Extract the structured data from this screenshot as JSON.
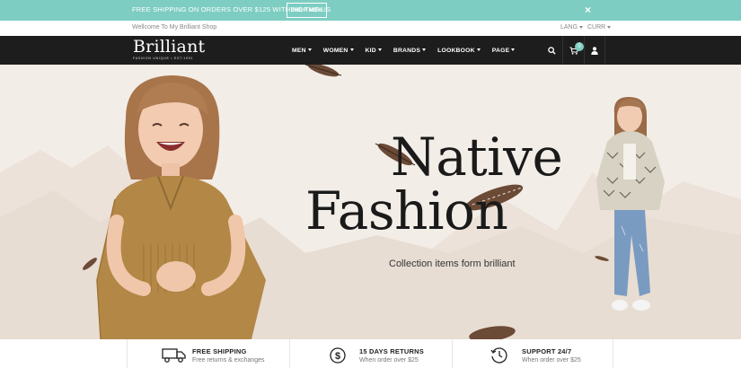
{
  "promo": {
    "text": "FREE SHIPPING ON ORDERS OVER $125 WITHING THE US",
    "button": "SHOP NOW"
  },
  "util": {
    "welcome": "Wellcome To My Brilliant Shop",
    "lang": "LANG",
    "curr": "CURR"
  },
  "brand": {
    "name": "Brilliant",
    "tagline": "FASHION UNIQUE • EST.1991"
  },
  "nav": {
    "items": [
      "MEN",
      "WOMEN",
      "KID",
      "BRANDS",
      "LOOKBOOK",
      "PAGE"
    ],
    "cart_count": "0"
  },
  "hero": {
    "line1": "Native",
    "line2": "Fashion",
    "subtitle": "Collection items form brilliant"
  },
  "features": [
    {
      "title": "FREE SHIPPING",
      "subtitle": "Free returns & exchanges",
      "icon": "truck-icon"
    },
    {
      "title": "15 DAYS RETURNS",
      "subtitle": "When order over $25",
      "icon": "dollar-icon"
    },
    {
      "title": "SUPPORT 24/7",
      "subtitle": "When order over $25",
      "icon": "clock-icon"
    }
  ],
  "colors": {
    "accent": "#7ecdc2",
    "nav_bg": "#1d1d1d",
    "hero_bg": "#f3ede7"
  }
}
